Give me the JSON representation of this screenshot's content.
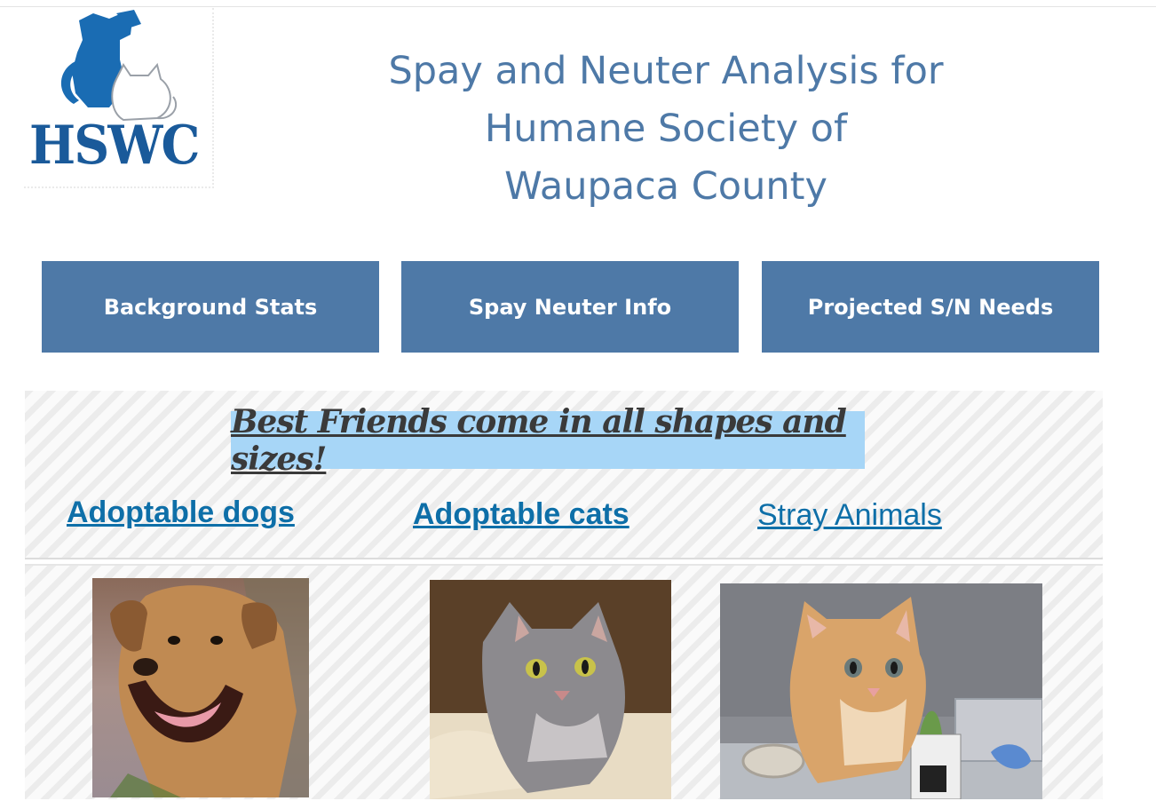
{
  "header": {
    "logo_text": "HSWC",
    "title_lines": [
      "Spay and Neuter Analysis for",
      "Humane Society of",
      "Waupaca County"
    ]
  },
  "nav": {
    "buttons": [
      {
        "label": "Background Stats"
      },
      {
        "label": "Spay Neuter Info"
      },
      {
        "label": "Projected S/N Needs"
      }
    ]
  },
  "promo": {
    "banner": "Best Friends come in all shapes and sizes!",
    "links": [
      {
        "label": "Adoptable dogs"
      },
      {
        "label": "Adoptable cats"
      },
      {
        "label": "Stray Animals"
      }
    ]
  },
  "colors": {
    "accent": "#4e79a7",
    "link": "#0e6fa8",
    "banner_bg": "#a7d6f7",
    "logo_blue": "#1a5a9a"
  },
  "icons": {
    "logo": "dog-and-cat-logo"
  }
}
